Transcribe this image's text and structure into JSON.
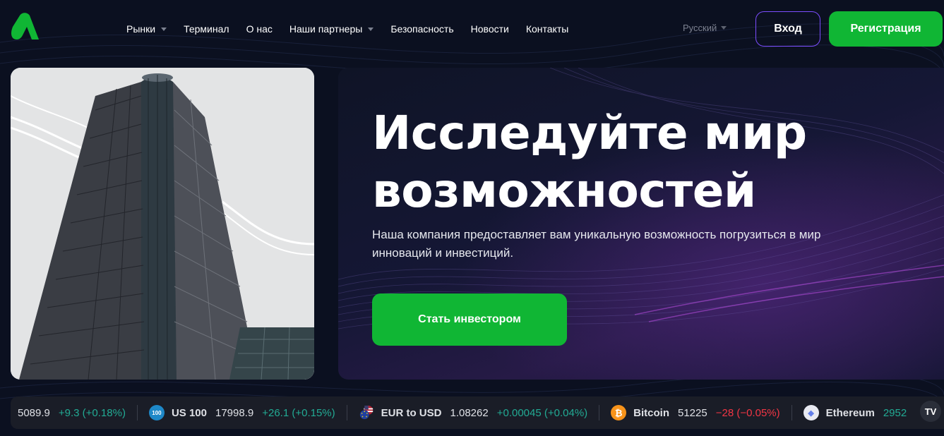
{
  "nav": {
    "items": [
      {
        "label": "Рынки",
        "dropdown": true
      },
      {
        "label": "Терминал",
        "dropdown": false
      },
      {
        "label": "О нас",
        "dropdown": false
      },
      {
        "label": "Наши партнеры",
        "dropdown": true
      },
      {
        "label": "Безопасность",
        "dropdown": false
      },
      {
        "label": "Новости",
        "dropdown": false
      },
      {
        "label": "Контакты",
        "dropdown": false
      }
    ]
  },
  "header": {
    "language": "Русский",
    "login_label": "Вход",
    "register_label": "Регистрация"
  },
  "hero": {
    "title": "Исследуйте мир возможностей",
    "subtitle": "Наша компания предоставляет вам уникальную возможность погрузиться в мир инноваций и инвестиций.",
    "cta_label": "Стать инвестором"
  },
  "ticker": {
    "items": [
      {
        "symbol": "",
        "price": "5089.9",
        "change": "+9.3 (+0.18%)",
        "direction": "up",
        "icon": "none"
      },
      {
        "symbol": "US 100",
        "price": "17998.9",
        "change": "+26.1 (+0.15%)",
        "direction": "up",
        "icon": "us100-icon",
        "icon_text": "100"
      },
      {
        "symbol": "EUR to USD",
        "price": "1.08262",
        "change": "+0.00045 (+0.04%)",
        "direction": "up",
        "icon": "eur-usd-flags-icon"
      },
      {
        "symbol": "Bitcoin",
        "price": "51225",
        "change": "−28 (−0.05%)",
        "direction": "down",
        "icon": "bitcoin-icon",
        "icon_text": "₿"
      },
      {
        "symbol": "Ethereum",
        "price": "2952",
        "change": "",
        "direction": "up",
        "icon": "ethereum-icon",
        "icon_text": "◆"
      }
    ],
    "brand": "TV"
  },
  "colors": {
    "accent_green": "#10b634",
    "login_border": "#7c4dff",
    "up": "#22ab94",
    "down": "#f23645",
    "background": "#0b1020"
  }
}
